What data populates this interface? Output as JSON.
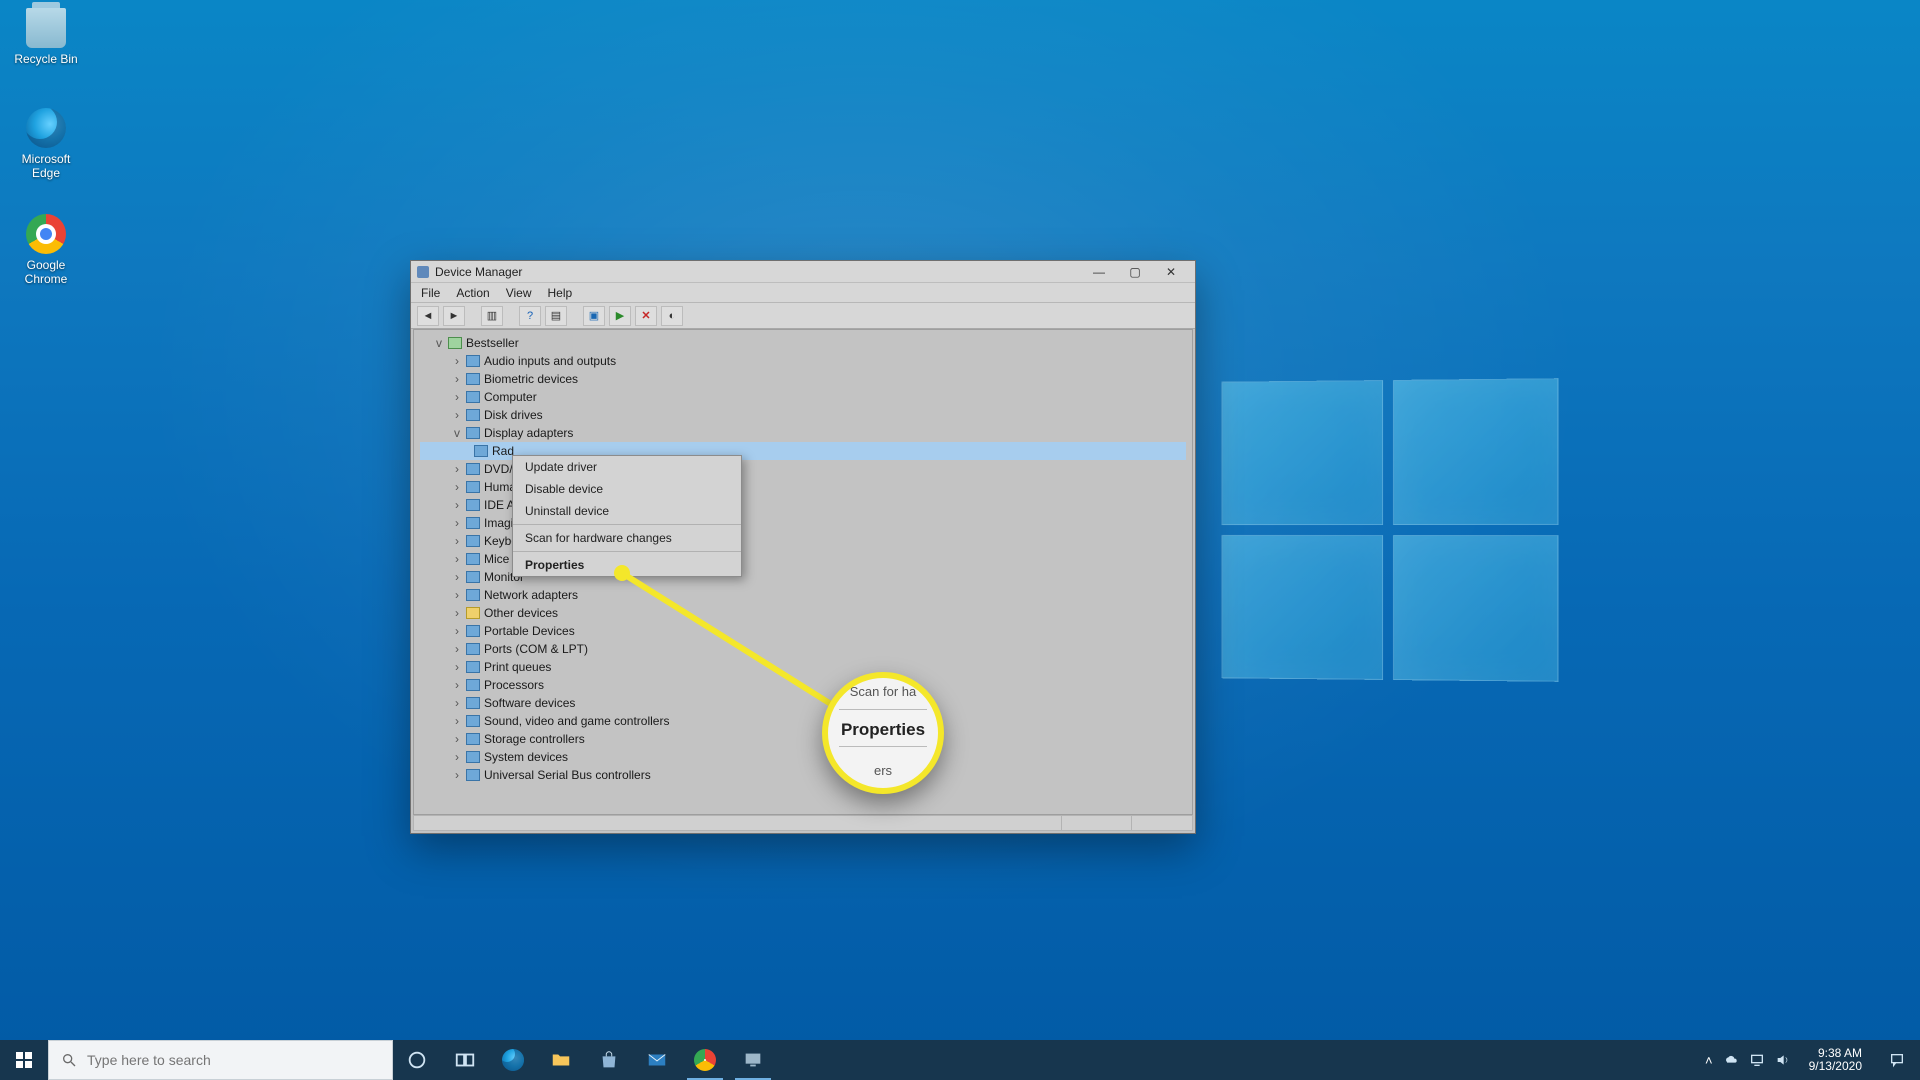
{
  "desktop_icons": {
    "recycle": "Recycle Bin",
    "edge": "Microsoft Edge",
    "chrome": "Google Chrome"
  },
  "window": {
    "title": "Device Manager",
    "menus": {
      "file": "File",
      "action": "Action",
      "view": "View",
      "help": "Help"
    },
    "controls": {
      "min": "—",
      "max": "▢",
      "close": "✕"
    },
    "root": "Bestseller",
    "categories": {
      "audio": "Audio inputs and outputs",
      "bio": "Biometric devices",
      "comp": "Computer",
      "disk": "Disk drives",
      "disp": "Display adapters",
      "disp_item": "Rad",
      "dvd": "DVD/C",
      "hid": "Human",
      "ide": "IDE AT",
      "img": "Imagin",
      "kbd": "Keybo",
      "mice": "Mice a",
      "mon": "Monitor",
      "net": "Network adapters",
      "other": "Other devices",
      "port": "Portable Devices",
      "com": "Ports (COM & LPT)",
      "printq": "Print queues",
      "proc": "Processors",
      "soft": "Software devices",
      "sound": "Sound, video and game controllers",
      "stor": "Storage controllers",
      "sys": "System devices",
      "usb": "Universal Serial Bus controllers"
    }
  },
  "context_menu": {
    "update": "Update driver",
    "disable": "Disable device",
    "uninstall": "Uninstall device",
    "scan": "Scan for hardware changes",
    "props": "Properties"
  },
  "magnifier": {
    "top": "Scan for ha",
    "main": "Properties",
    "bottom": "ers"
  },
  "taskbar": {
    "search_placeholder": "Type here to search",
    "time": "9:38 AM",
    "date": "9/13/2020"
  }
}
